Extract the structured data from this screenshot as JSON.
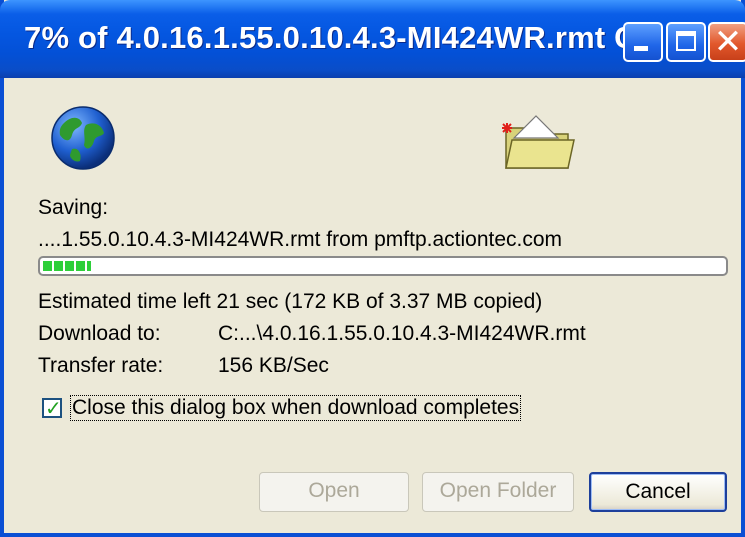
{
  "window": {
    "title": "7% of 4.0.16.1.55.0.10.4.3-MI424WR.rmt C...",
    "controls": {
      "minimize": "minimize-icon",
      "maximize": "maximize-icon",
      "close": "close-icon",
      "close_glyph": "✕"
    }
  },
  "icons": {
    "source": "globe-icon",
    "destination": "folder-icon"
  },
  "download": {
    "saving_label": "Saving:",
    "filename": "....1.55.0.10.4.3-MI424WR.rmt from pmftp.actiontec.com",
    "progress_fraction": 0.07,
    "estimated_time": "Estimated time left  21 sec (172 KB of 3.37 MB copied)",
    "download_to_label": "Download to:",
    "download_to_value": "C:...\\4.0.16.1.55.0.10.4.3-MI424WR.rmt",
    "transfer_rate_label": "Transfer rate:",
    "transfer_rate_value": "156 KB/Sec"
  },
  "options": {
    "close_on_complete_label": "Close this dialog box when download completes",
    "close_on_complete_checked": true,
    "check_glyph": "✓"
  },
  "buttons": {
    "open": "Open",
    "open_folder": "Open Folder",
    "cancel": "Cancel"
  },
  "colors": {
    "titlebar": "#0350d6",
    "progress": "#2ecf3a",
    "dialog_bg": "#ece9d8"
  }
}
